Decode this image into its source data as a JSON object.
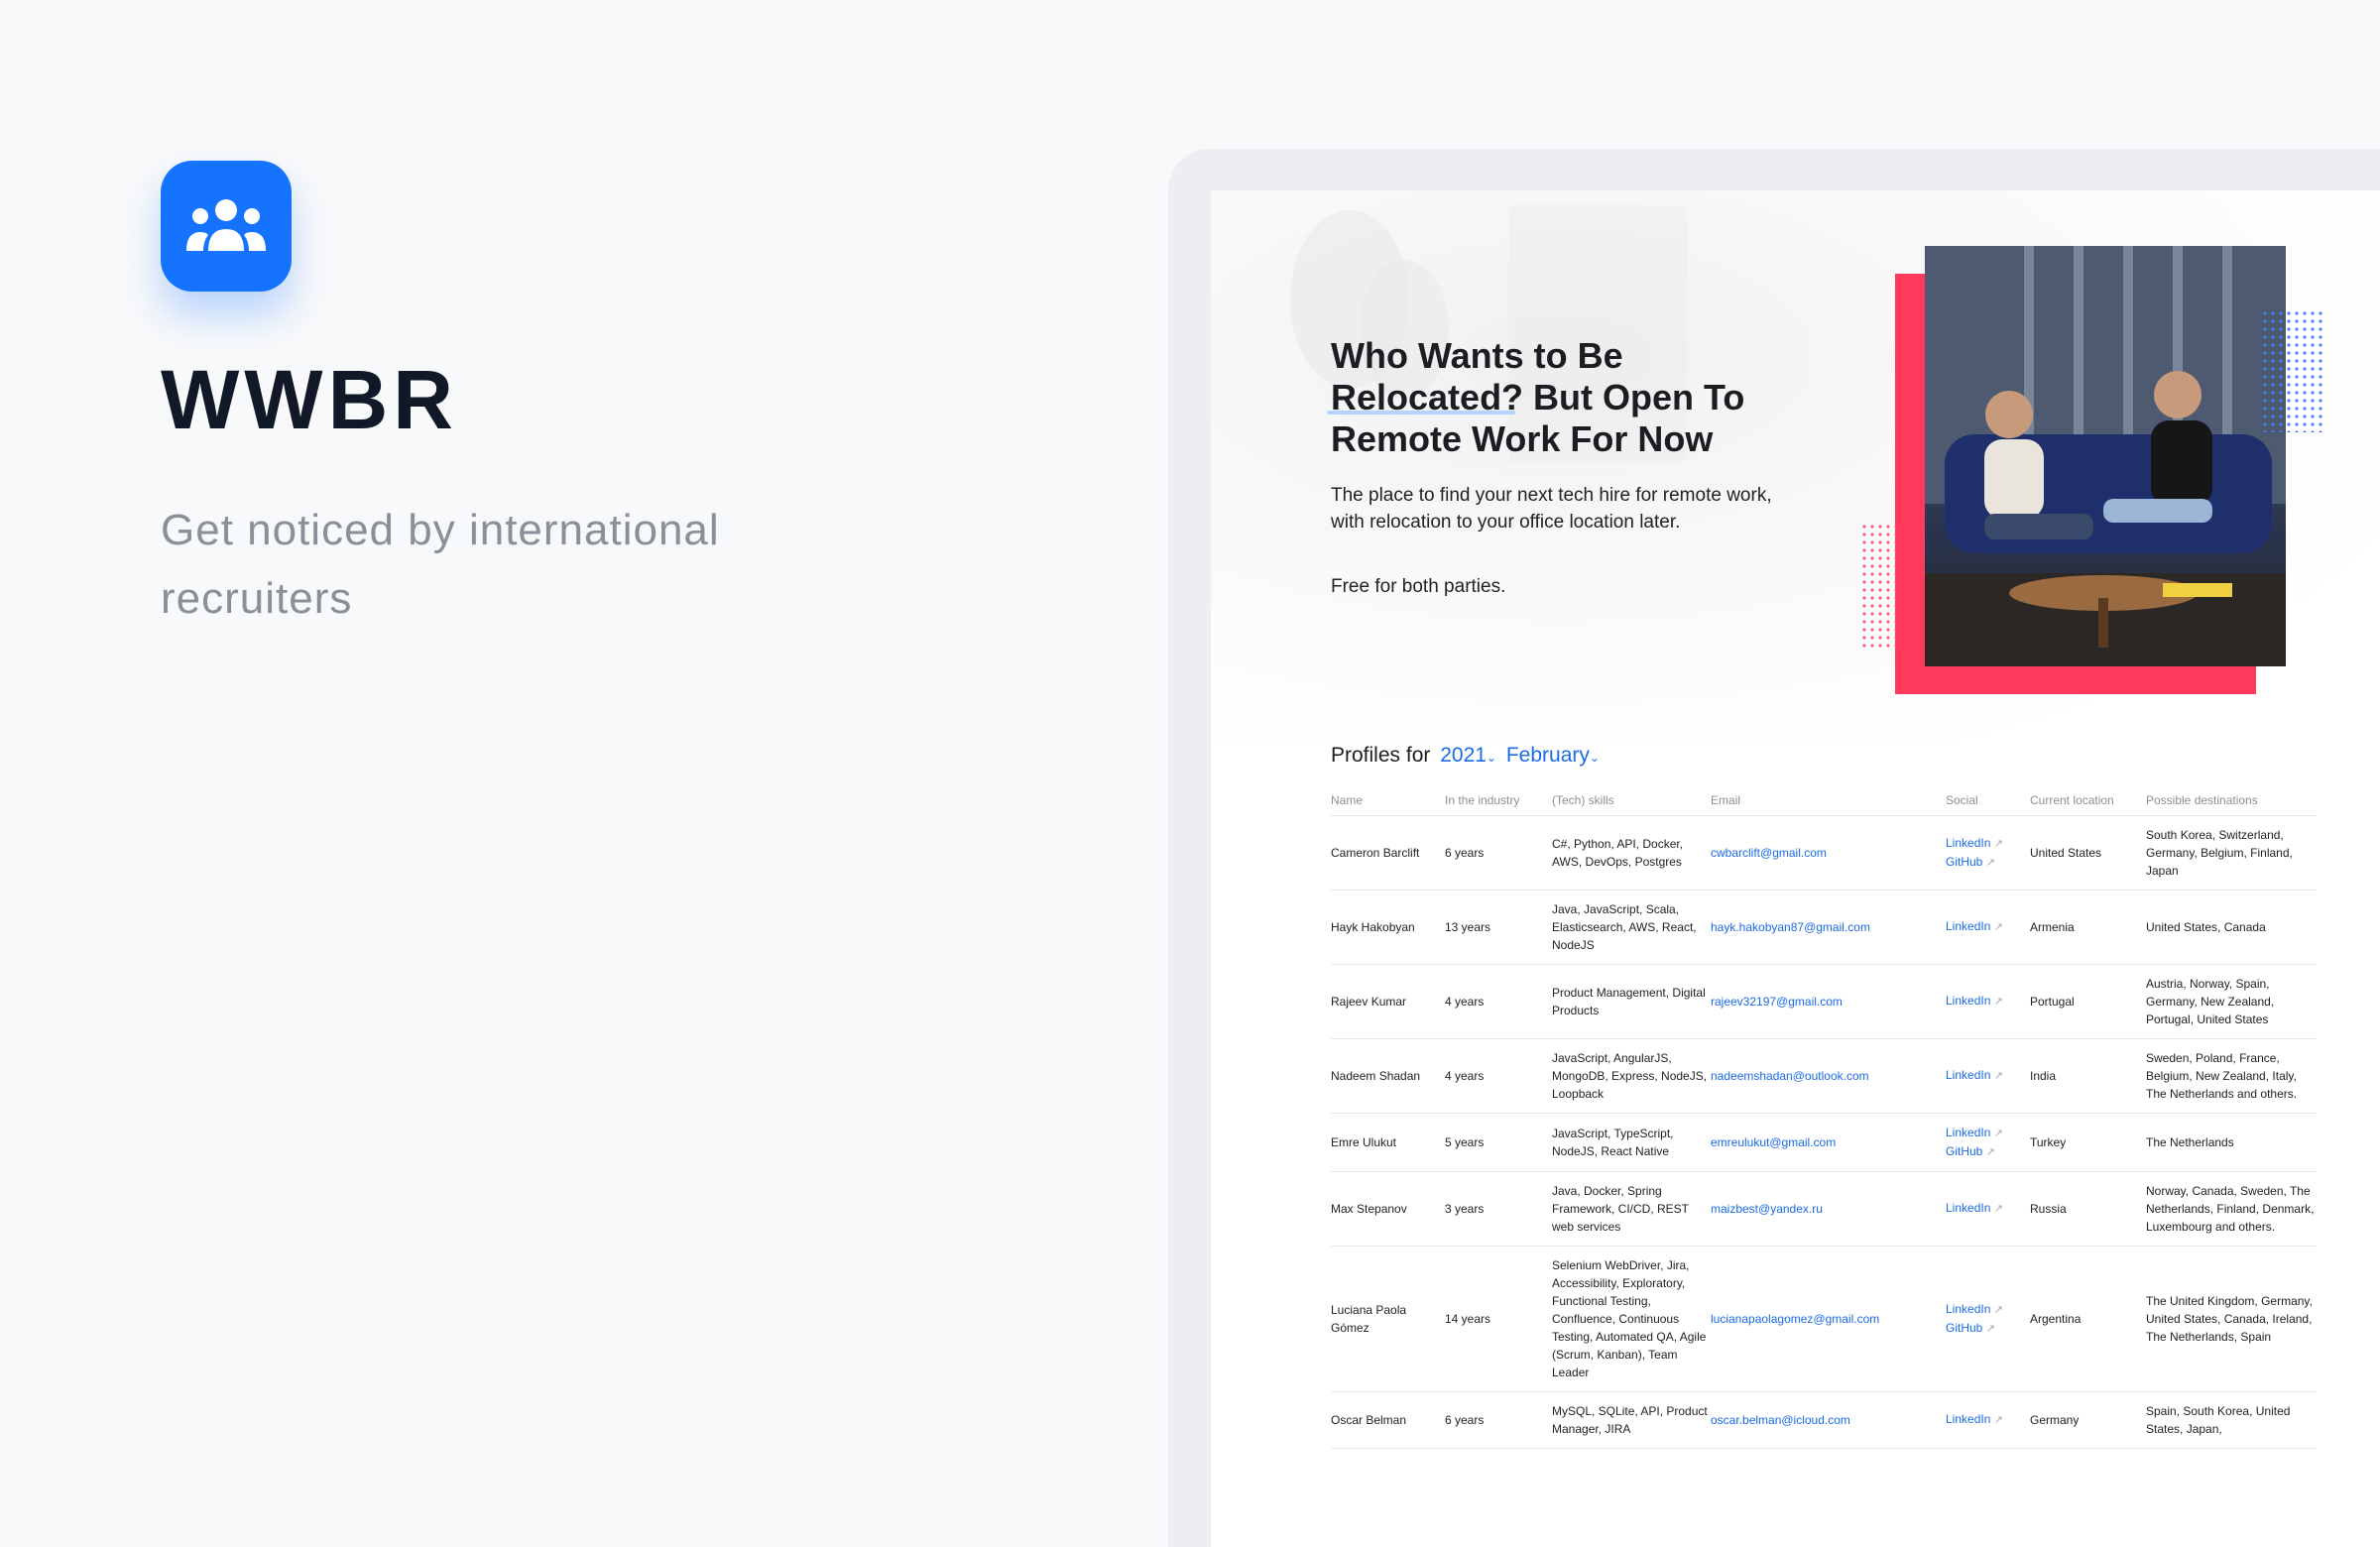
{
  "app": {
    "name": "WWBR",
    "tagline": "Get noticed by international recruiters",
    "icon": "users-group-icon",
    "brand_color": "#1573ff"
  },
  "hero": {
    "title": "Who Wants to Be Relocated? But Open To Remote Work For Now",
    "description": "The place to find your next tech hire for remote work, with relocation to your office location later.",
    "free_note": "Free for both parties."
  },
  "profiles": {
    "heading": "Profiles for",
    "year": "2021",
    "month": "February",
    "columns": [
      "Name",
      "In the industry",
      "(Tech) skills",
      "Email",
      "Social",
      "Current location",
      "Possible destinations"
    ],
    "rows": [
      {
        "name": "Cameron Barclift",
        "years": "6 years",
        "skills": "C#, Python, API, Docker, AWS, DevOps, Postgres",
        "email": "cwbarclift@gmail.com",
        "social": [
          "LinkedIn",
          "GitHub"
        ],
        "location": "United States",
        "destinations": "South Korea, Switzerland, Germany, Belgium, Finland, Japan"
      },
      {
        "name": "Hayk Hakobyan",
        "years": "13 years",
        "skills": "Java, JavaScript, Scala, Elasticsearch, AWS, React, NodeJS",
        "email": "hayk.hakobyan87@gmail.com",
        "social": [
          "LinkedIn"
        ],
        "location": "Armenia",
        "destinations": "United States, Canada"
      },
      {
        "name": "Rajeev Kumar",
        "years": "4 years",
        "skills": "Product Management, Digital Products",
        "email": "rajeev32197@gmail.com",
        "social": [
          "LinkedIn"
        ],
        "location": "Portugal",
        "destinations": "Austria, Norway, Spain, Germany, New Zealand, Portugal, United States"
      },
      {
        "name": "Nadeem Shadan",
        "years": "4 years",
        "skills": "JavaScript, AngularJS, MongoDB, Express, NodeJS, Loopback",
        "email": "nadeemshadan@outlook.com",
        "social": [
          "LinkedIn"
        ],
        "location": "India",
        "destinations": "Sweden, Poland, France, Belgium, New Zealand, Italy, The Netherlands and others."
      },
      {
        "name": "Emre Ulukut",
        "years": "5 years",
        "skills": "JavaScript, TypeScript, NodeJS, React Native",
        "email": "emreulukut@gmail.com",
        "social": [
          "LinkedIn",
          "GitHub"
        ],
        "location": "Turkey",
        "destinations": "The Netherlands"
      },
      {
        "name": "Max Stepanov",
        "years": "3 years",
        "skills": "Java, Docker, Spring Framework, CI/CD, REST web services",
        "email": "maizbest@yandex.ru",
        "social": [
          "LinkedIn"
        ],
        "location": "Russia",
        "destinations": "Norway, Canada, Sweden, The Netherlands, Finland, Denmark, Luxembourg and others."
      },
      {
        "name": "Luciana Paola Gómez",
        "years": "14 years",
        "skills": "Selenium WebDriver, Jira, Accessibility, Exploratory, Functional Testing, Confluence, Continuous Testing, Automated QA, Agile (Scrum, Kanban), Team Leader",
        "email": "lucianapaolagomez@gmail.com",
        "social": [
          "LinkedIn",
          "GitHub"
        ],
        "location": "Argentina",
        "destinations": "The United Kingdom, Germany, United States, Canada, Ireland, The Netherlands, Spain"
      },
      {
        "name": "Oscar Belman",
        "years": "6 years",
        "skills": "MySQL, SQLite, API, Product Manager, JIRA",
        "email": "oscar.belman@icloud.com",
        "social": [
          "LinkedIn"
        ],
        "location": "Germany",
        "destinations": "Spain, South Korea, United States, Japan,"
      }
    ]
  }
}
